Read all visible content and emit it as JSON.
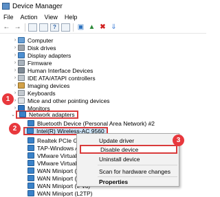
{
  "window": {
    "title": "Device Manager"
  },
  "menubar": [
    "File",
    "Action",
    "View",
    "Help"
  ],
  "toolbar": {
    "icons": [
      "back-arrow-icon",
      "forward-arrow-icon",
      "properties-icon",
      "details-icon",
      "help-icon",
      "view-icon",
      "monitor-icon",
      "update-driver-icon",
      "delete-icon",
      "download-icon"
    ]
  },
  "tree": {
    "categories": [
      {
        "label": "Computer",
        "icon": "computer-icon"
      },
      {
        "label": "Disk drives",
        "icon": "disk-icon"
      },
      {
        "label": "Display adapters",
        "icon": "display-adapter-icon"
      },
      {
        "label": "Firmware",
        "icon": "firmware-icon"
      },
      {
        "label": "Human Interface Devices",
        "icon": "hid-icon"
      },
      {
        "label": "IDE ATA/ATAPI controllers",
        "icon": "ide-icon"
      },
      {
        "label": "Imaging devices",
        "icon": "camera-icon"
      },
      {
        "label": "Keyboards",
        "icon": "keyboard-icon"
      },
      {
        "label": "Mice and other pointing devices",
        "icon": "mouse-icon"
      },
      {
        "label": "Monitors",
        "icon": "monitor-icon"
      },
      {
        "label": "Network adapters",
        "icon": "network-adapter-icon"
      }
    ],
    "network_children": [
      {
        "label": "Bluetooth Device (Personal Area Network) #2"
      },
      {
        "label": "Intel(R) Wireless-AC 9560"
      },
      {
        "label": "Realtek PCIe GbE Family"
      },
      {
        "label": "TAP-Windows Adapter"
      },
      {
        "label": "VMware Virtual Ethernet"
      },
      {
        "label": "VMware Virtual Ethernet"
      },
      {
        "label": "WAN Miniport (IKEv2)"
      },
      {
        "label": "WAN Miniport (IP)"
      },
      {
        "label": "WAN Miniport (IPv6)"
      },
      {
        "label": "WAN Miniport (L2TP)"
      }
    ]
  },
  "context_menu": {
    "items": [
      {
        "label": "Update driver"
      },
      {
        "label": "Disable device"
      },
      {
        "label": "Uninstall device"
      },
      {
        "label": "Scan for hardware changes"
      },
      {
        "label": "Properties"
      }
    ]
  },
  "annotations": {
    "step1": "1",
    "step2": "2",
    "step3": "3"
  },
  "colors": {
    "annotation": "#e8383d",
    "selection": "#cce4f7"
  }
}
